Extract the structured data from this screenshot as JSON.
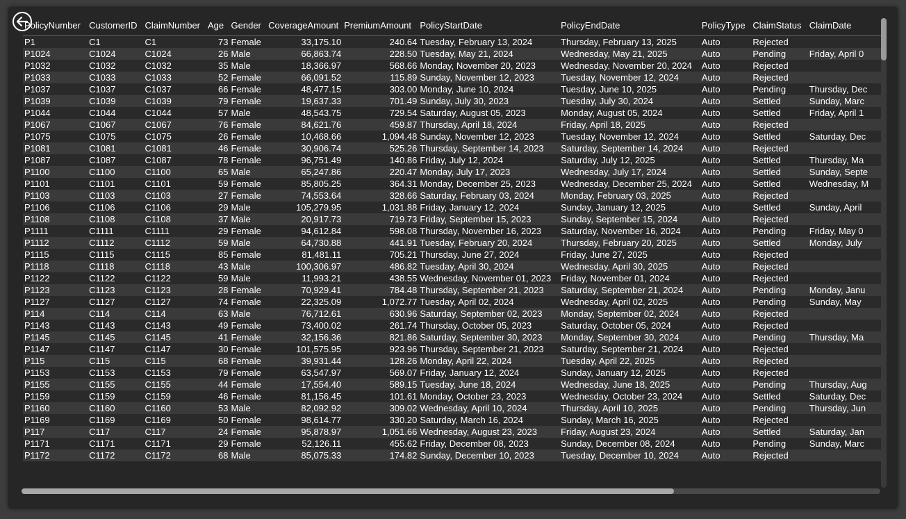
{
  "header": {
    "back_icon": "back-arrow-circle-icon"
  },
  "table": {
    "columns": [
      "PolicyNumber",
      "CustomerID",
      "ClaimNumber",
      "Age",
      "Gender",
      "CoverageAmount",
      "PremiumAmount",
      "PolicyStartDate",
      "PolicyEndDate",
      "PolicyType",
      "ClaimStatus",
      "ClaimDate"
    ],
    "rows": [
      [
        "P1",
        "C1",
        "C1",
        "73",
        "Female",
        "33,175.10",
        "240.64",
        "Tuesday, February 13, 2024",
        "Thursday, February 13, 2025",
        "Auto",
        "Rejected",
        ""
      ],
      [
        "P1024",
        "C1024",
        "C1024",
        "26",
        "Male",
        "66,863.74",
        "228.50",
        "Tuesday, May 21, 2024",
        "Wednesday, May 21, 2025",
        "Auto",
        "Pending",
        "Friday, April 0"
      ],
      [
        "P1032",
        "C1032",
        "C1032",
        "35",
        "Male",
        "18,366.97",
        "568.66",
        "Monday, November 20, 2023",
        "Wednesday, November 20, 2024",
        "Auto",
        "Rejected",
        ""
      ],
      [
        "P1033",
        "C1033",
        "C1033",
        "52",
        "Female",
        "66,091.52",
        "115.89",
        "Sunday, November 12, 2023",
        "Tuesday, November 12, 2024",
        "Auto",
        "Rejected",
        ""
      ],
      [
        "P1037",
        "C1037",
        "C1037",
        "66",
        "Female",
        "48,477.15",
        "303.00",
        "Monday, June 10, 2024",
        "Tuesday, June 10, 2025",
        "Auto",
        "Pending",
        "Thursday, Dec"
      ],
      [
        "P1039",
        "C1039",
        "C1039",
        "79",
        "Female",
        "19,637.33",
        "701.49",
        "Sunday, July 30, 2023",
        "Tuesday, July 30, 2024",
        "Auto",
        "Settled",
        "Sunday, Marc"
      ],
      [
        "P1044",
        "C1044",
        "C1044",
        "57",
        "Male",
        "48,543.75",
        "729.54",
        "Saturday, August 05, 2023",
        "Monday, August 05, 2024",
        "Auto",
        "Settled",
        "Friday, April 1"
      ],
      [
        "P1067",
        "C1067",
        "C1067",
        "76",
        "Female",
        "84,621.76",
        "459.87",
        "Thursday, April 18, 2024",
        "Friday, April 18, 2025",
        "Auto",
        "Rejected",
        ""
      ],
      [
        "P1075",
        "C1075",
        "C1075",
        "26",
        "Female",
        "10,468.66",
        "1,094.48",
        "Sunday, November 12, 2023",
        "Tuesday, November 12, 2024",
        "Auto",
        "Settled",
        "Saturday, Dec"
      ],
      [
        "P1081",
        "C1081",
        "C1081",
        "46",
        "Female",
        "30,906.74",
        "525.26",
        "Thursday, September 14, 2023",
        "Saturday, September 14, 2024",
        "Auto",
        "Rejected",
        ""
      ],
      [
        "P1087",
        "C1087",
        "C1087",
        "78",
        "Female",
        "96,751.49",
        "140.86",
        "Friday, July 12, 2024",
        "Saturday, July 12, 2025",
        "Auto",
        "Settled",
        "Thursday, Ma"
      ],
      [
        "P1100",
        "C1100",
        "C1100",
        "65",
        "Male",
        "65,247.86",
        "220.47",
        "Monday, July 17, 2023",
        "Wednesday, July 17, 2024",
        "Auto",
        "Settled",
        "Sunday, Septe"
      ],
      [
        "P1101",
        "C1101",
        "C1101",
        "59",
        "Female",
        "85,805.25",
        "364.31",
        "Monday, December 25, 2023",
        "Wednesday, December 25, 2024",
        "Auto",
        "Settled",
        "Wednesday, M"
      ],
      [
        "P1103",
        "C1103",
        "C1103",
        "27",
        "Female",
        "74,553.64",
        "328.66",
        "Saturday, February 03, 2024",
        "Monday, February 03, 2025",
        "Auto",
        "Rejected",
        ""
      ],
      [
        "P1106",
        "C1106",
        "C1106",
        "29",
        "Male",
        "105,279.95",
        "1,031.88",
        "Friday, January 12, 2024",
        "Sunday, January 12, 2025",
        "Auto",
        "Settled",
        "Sunday, April"
      ],
      [
        "P1108",
        "C1108",
        "C1108",
        "37",
        "Male",
        "20,917.73",
        "719.73",
        "Friday, September 15, 2023",
        "Sunday, September 15, 2024",
        "Auto",
        "Rejected",
        ""
      ],
      [
        "P1111",
        "C1111",
        "C1111",
        "29",
        "Female",
        "94,612.84",
        "598.08",
        "Thursday, November 16, 2023",
        "Saturday, November 16, 2024",
        "Auto",
        "Pending",
        "Friday, May 0"
      ],
      [
        "P1112",
        "C1112",
        "C1112",
        "59",
        "Male",
        "64,730.88",
        "441.91",
        "Tuesday, February 20, 2024",
        "Thursday, February 20, 2025",
        "Auto",
        "Settled",
        "Monday, July"
      ],
      [
        "P1115",
        "C1115",
        "C1115",
        "85",
        "Female",
        "81,481.11",
        "705.21",
        "Thursday, June 27, 2024",
        "Friday, June 27, 2025",
        "Auto",
        "Rejected",
        ""
      ],
      [
        "P1118",
        "C1118",
        "C1118",
        "43",
        "Male",
        "100,306.97",
        "486.82",
        "Tuesday, April 30, 2024",
        "Wednesday, April 30, 2025",
        "Auto",
        "Rejected",
        ""
      ],
      [
        "P1122",
        "C1122",
        "C1122",
        "59",
        "Male",
        "11,993.21",
        "438.55",
        "Wednesday, November 01, 2023",
        "Friday, November 01, 2024",
        "Auto",
        "Rejected",
        ""
      ],
      [
        "P1123",
        "C1123",
        "C1123",
        "28",
        "Female",
        "70,929.41",
        "784.48",
        "Thursday, September 21, 2023",
        "Saturday, September 21, 2024",
        "Auto",
        "Pending",
        "Monday, Janu"
      ],
      [
        "P1127",
        "C1127",
        "C1127",
        "74",
        "Female",
        "22,325.09",
        "1,072.77",
        "Tuesday, April 02, 2024",
        "Wednesday, April 02, 2025",
        "Auto",
        "Pending",
        "Sunday, May"
      ],
      [
        "P114",
        "C114",
        "C114",
        "63",
        "Male",
        "76,712.61",
        "630.96",
        "Saturday, September 02, 2023",
        "Monday, September 02, 2024",
        "Auto",
        "Rejected",
        ""
      ],
      [
        "P1143",
        "C1143",
        "C1143",
        "49",
        "Female",
        "73,400.02",
        "261.74",
        "Thursday, October 05, 2023",
        "Saturday, October 05, 2024",
        "Auto",
        "Rejected",
        ""
      ],
      [
        "P1145",
        "C1145",
        "C1145",
        "41",
        "Female",
        "32,156.36",
        "821.86",
        "Saturday, September 30, 2023",
        "Monday, September 30, 2024",
        "Auto",
        "Pending",
        "Thursday, Ma"
      ],
      [
        "P1147",
        "C1147",
        "C1147",
        "30",
        "Female",
        "101,575.95",
        "923.96",
        "Thursday, September 21, 2023",
        "Saturday, September 21, 2024",
        "Auto",
        "Rejected",
        ""
      ],
      [
        "P115",
        "C115",
        "C115",
        "68",
        "Female",
        "39,931.44",
        "128.26",
        "Monday, April 22, 2024",
        "Tuesday, April 22, 2025",
        "Auto",
        "Rejected",
        ""
      ],
      [
        "P1153",
        "C1153",
        "C1153",
        "79",
        "Female",
        "63,547.97",
        "569.07",
        "Friday, January 12, 2024",
        "Sunday, January 12, 2025",
        "Auto",
        "Rejected",
        ""
      ],
      [
        "P1155",
        "C1155",
        "C1155",
        "44",
        "Female",
        "17,554.40",
        "589.15",
        "Tuesday, June 18, 2024",
        "Wednesday, June 18, 2025",
        "Auto",
        "Pending",
        "Thursday, Aug"
      ],
      [
        "P1159",
        "C1159",
        "C1159",
        "46",
        "Female",
        "81,156.45",
        "101.61",
        "Monday, October 23, 2023",
        "Wednesday, October 23, 2024",
        "Auto",
        "Settled",
        "Saturday, Dec"
      ],
      [
        "P1160",
        "C1160",
        "C1160",
        "53",
        "Male",
        "82,092.92",
        "309.02",
        "Wednesday, April 10, 2024",
        "Thursday, April 10, 2025",
        "Auto",
        "Pending",
        "Thursday, Jun"
      ],
      [
        "P1169",
        "C1169",
        "C1169",
        "50",
        "Female",
        "98,614.77",
        "330.20",
        "Saturday, March 16, 2024",
        "Sunday, March 16, 2025",
        "Auto",
        "Rejected",
        ""
      ],
      [
        "P117",
        "C117",
        "C117",
        "24",
        "Female",
        "95,878.97",
        "1,051.66",
        "Wednesday, August 23, 2023",
        "Friday, August 23, 2024",
        "Auto",
        "Settled",
        "Saturday, Jan"
      ],
      [
        "P1171",
        "C1171",
        "C1171",
        "29",
        "Female",
        "52,126.11",
        "455.62",
        "Friday, December 08, 2023",
        "Sunday, December 08, 2024",
        "Auto",
        "Pending",
        "Sunday, Marc"
      ],
      [
        "P1172",
        "C1172",
        "C1172",
        "68",
        "Male",
        "85,075.33",
        "174.82",
        "Sunday, December 10, 2023",
        "Tuesday, December 10, 2024",
        "Auto",
        "Rejected",
        ""
      ]
    ]
  },
  "scrollbars": {
    "vertical_position_fraction": 0.0,
    "vertical_visible_fraction": 0.09,
    "horizontal_position_fraction": 0.0,
    "horizontal_visible_fraction": 0.76
  },
  "colors": {
    "background": "#262626",
    "row_odd": "#2a2a2a",
    "row_even": "#3a3a3a",
    "header_divider": "#2c6e9e",
    "text": "#ffffff"
  }
}
